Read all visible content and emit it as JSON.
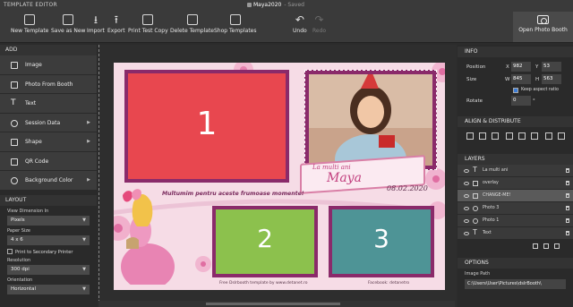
{
  "titlebar": {
    "app_title": "TEMPLATE EDITOR",
    "doc_name": "Maya2020",
    "saved": "- Saved"
  },
  "toolbar": {
    "new": "New Template",
    "save_as": "Save as New",
    "import": "Import",
    "export": "Export",
    "print_test": "Print Test Copy",
    "delete": "Delete Template",
    "shop": "Shop Templates",
    "undo": "Undo",
    "redo": "Redo",
    "open_pb": "Open Photo Booth"
  },
  "add_panel": {
    "header": "ADD",
    "items": [
      {
        "label": "Image",
        "icon": "image-icon"
      },
      {
        "label": "Photo From Booth",
        "icon": "camera-icon"
      },
      {
        "label": "Text",
        "icon": "text-icon"
      },
      {
        "label": "Session Data",
        "icon": "gear-icon"
      },
      {
        "label": "Shape",
        "icon": "shape-icon"
      },
      {
        "label": "QR Code",
        "icon": "qr-icon"
      },
      {
        "label": "Background Color",
        "icon": "palette-icon"
      }
    ]
  },
  "layout_panel": {
    "header": "LAYOUT",
    "view_dimension_label": "View Dimension In",
    "view_dimension_value": "Pixels",
    "paper_size_label": "Paper Size",
    "paper_size_value": "4 x 6",
    "secondary_printer": "Print to Secondary Printer",
    "resolution_label": "Resolution",
    "resolution_value": "300 dpi",
    "orientation_label": "Orientation",
    "orientation_value": "Horizontal"
  },
  "template": {
    "photo1": "1",
    "photo2": "2",
    "photo3": "3",
    "greeting": "La multi ani",
    "name": "Maya",
    "date": "08.02.2020",
    "thanks": "Multumim pentru aceste frumoase momente!",
    "footer_left": "Free Dslrbooth template by www.detanet.ro",
    "footer_right": "Facebook: detanetro"
  },
  "info_panel": {
    "header": "INFO",
    "position_label": "Position",
    "x_label": "X",
    "x_value": "982",
    "y_label": "Y",
    "y_value": "53",
    "size_label": "Size",
    "w_label": "W",
    "w_value": "845",
    "h_label": "H",
    "h_value": "563",
    "keep_aspect": "Keep aspect ratio",
    "rotate_label": "Rotate",
    "rotate_value": "0",
    "degree": "°"
  },
  "align_panel": {
    "header": "ALIGN & DISTRIBUTE"
  },
  "layers_panel": {
    "header": "LAYERS",
    "layers": [
      {
        "name": "La multi ani",
        "type": "text"
      },
      {
        "name": "overlay",
        "type": "image"
      },
      {
        "name": "CHANGE-ME!",
        "type": "image"
      },
      {
        "name": "Photo 3",
        "type": "photo"
      },
      {
        "name": "Photo 1",
        "type": "photo"
      },
      {
        "name": "Text",
        "type": "text"
      }
    ]
  },
  "options_panel": {
    "header": "OPTIONS",
    "image_path_label": "Image Path",
    "image_path_value": "C:\\Users\\User\\Pictures\\dslrBooth\\"
  },
  "colors": {
    "photo1": "#e8474f",
    "photo2": "#8cc14d",
    "photo3": "#4e9496",
    "frame": "#8a2a6a",
    "accent_pink": "#d94b8c"
  }
}
